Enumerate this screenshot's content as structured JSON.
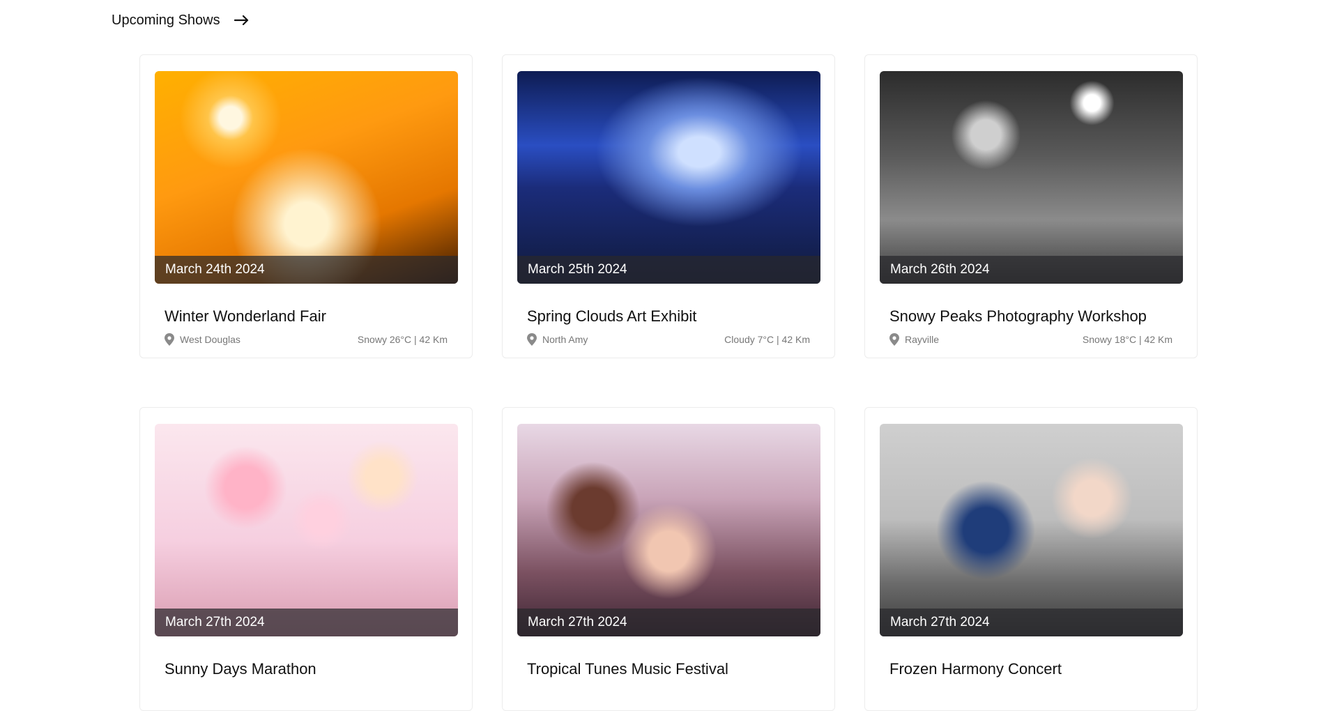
{
  "section": {
    "title": "Upcoming Shows",
    "arrow_icon": "arrow-right-icon"
  },
  "shows": [
    {
      "date": "March 24th 2024",
      "title": "Winter Wonderland Fair",
      "location": "West Douglas",
      "weather": "Snowy 26°C | 42 Km",
      "image": "concert-stage-orange-lights"
    },
    {
      "date": "March 25th 2024",
      "title": "Spring Clouds Art Exhibit",
      "location": "North Amy",
      "weather": "Cloudy 7°C | 42 Km",
      "image": "conference-audience-blue-stage"
    },
    {
      "date": "March 26th 2024",
      "title": "Snowy Peaks Photography Workshop",
      "location": "Rayville",
      "weather": "Snowy 18°C | 42 Km",
      "image": "microphone-black-white"
    },
    {
      "date": "March 27th 2024",
      "title": "Sunny Days Marathon",
      "location": "",
      "weather": "",
      "image": "party-pink-balloons"
    },
    {
      "date": "March 27th 2024",
      "title": "Tropical Tunes Music Festival",
      "location": "",
      "weather": "",
      "image": "party-friends-celebrating"
    },
    {
      "date": "March 27th 2024",
      "title": "Frozen Harmony Concert",
      "location": "",
      "weather": "",
      "image": "catering-buffet-people"
    }
  ]
}
